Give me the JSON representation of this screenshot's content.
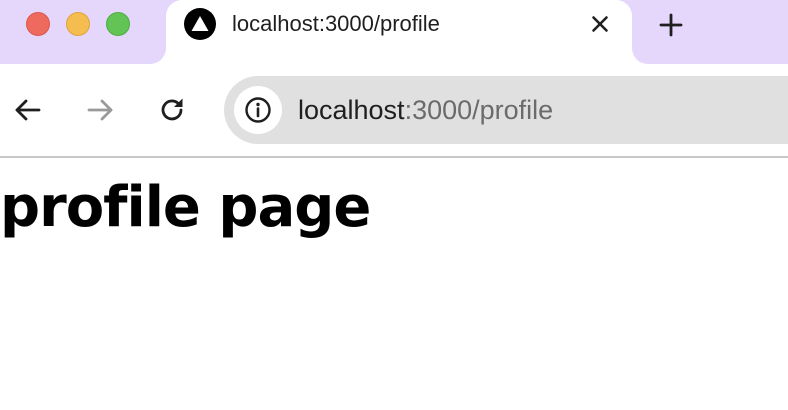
{
  "browser": {
    "tab": {
      "title": "localhost:3000/profile",
      "favicon": "triangle-logo-icon"
    },
    "address_bar": {
      "host": "localhost",
      "path": ":3000/profile"
    },
    "icons": {
      "back": "arrow-left-icon",
      "forward": "arrow-right-icon",
      "reload": "reload-icon",
      "site_info": "info-icon",
      "tab_close": "close-icon",
      "new_tab": "plus-icon"
    },
    "colors": {
      "tab_strip": "#e5d6fb",
      "omnibox": "#e0e0e0",
      "traffic_close": "#ee6a5f",
      "traffic_minimize": "#f5bd4f",
      "traffic_maximize": "#61c454"
    }
  },
  "page": {
    "heading": "profile page"
  }
}
